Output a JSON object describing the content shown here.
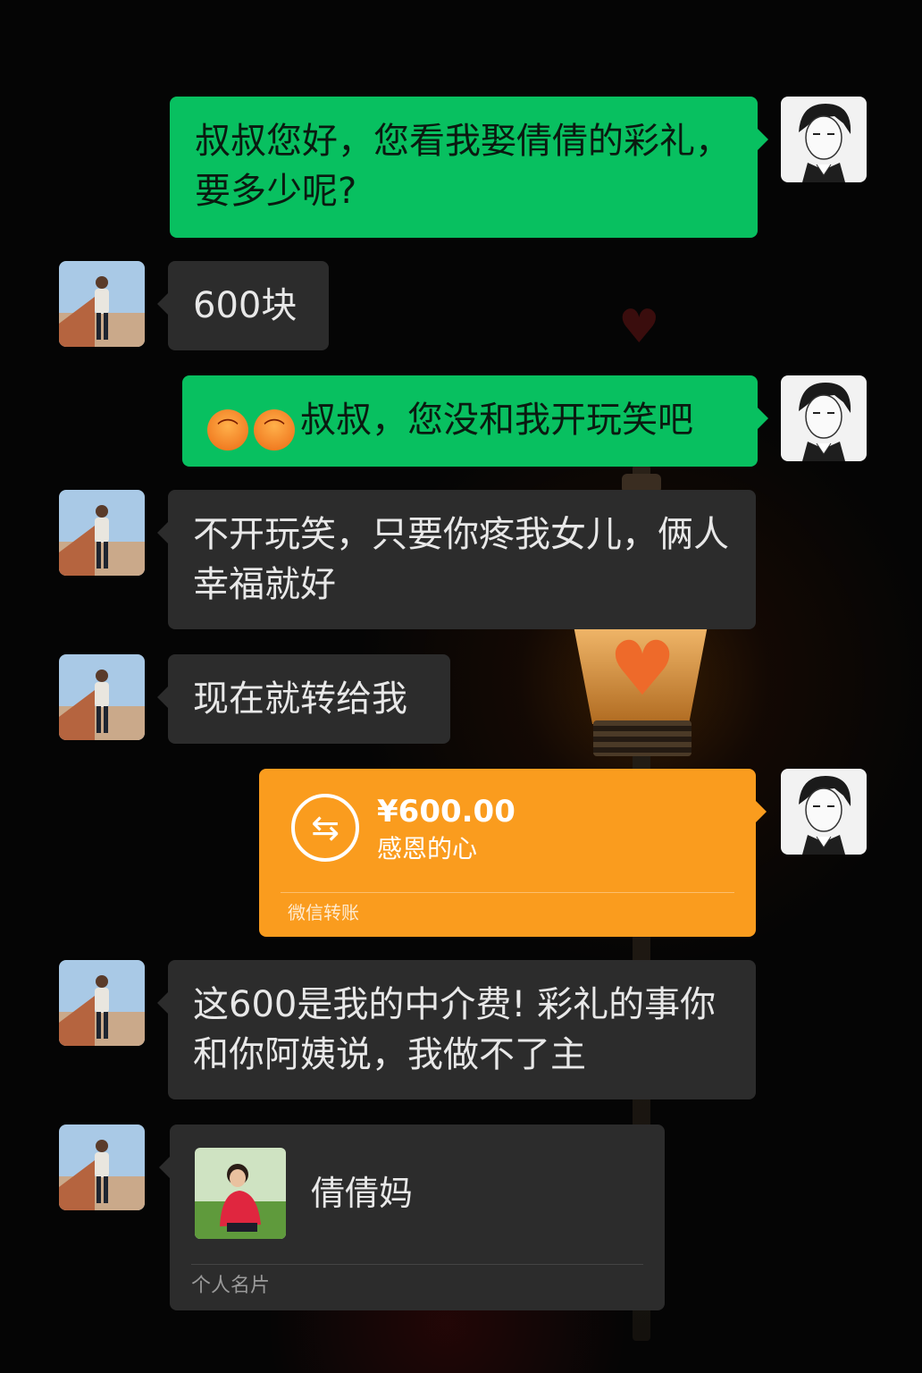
{
  "chat": {
    "messages": [
      {
        "sender": "me",
        "type": "text",
        "text": "叔叔您好，您看我娶倩倩的彩礼，要多少呢?"
      },
      {
        "sender": "other",
        "type": "text",
        "text": "600块"
      },
      {
        "sender": "me",
        "type": "text",
        "emoji": [
          "angry-face-emoji",
          "angry-face-emoji"
        ],
        "text": "叔叔，您没和我开玩笑吧"
      },
      {
        "sender": "other",
        "type": "text",
        "text": "不开玩笑，只要你疼我女儿，俩人幸福就好"
      },
      {
        "sender": "other",
        "type": "text",
        "text": "现在就转给我"
      },
      {
        "sender": "me",
        "type": "transfer",
        "amount": "¥600.00",
        "note": "感恩的心",
        "footer": "微信转账"
      },
      {
        "sender": "other",
        "type": "text",
        "text": "这600是我的中介费! 彩礼的事你和你阿姨说，我做不了主"
      },
      {
        "sender": "other",
        "type": "contact-card",
        "name": "倩倩妈",
        "footer": "个人名片"
      }
    ]
  },
  "icons": {
    "transfer": "transfer-arrows-icon",
    "emoji": "angry-face-emoji"
  },
  "colors": {
    "background": "#050505",
    "my_bubble": "#08c060",
    "other_bubble": "#2c2c2c",
    "transfer_card": "#fa9c1e"
  }
}
